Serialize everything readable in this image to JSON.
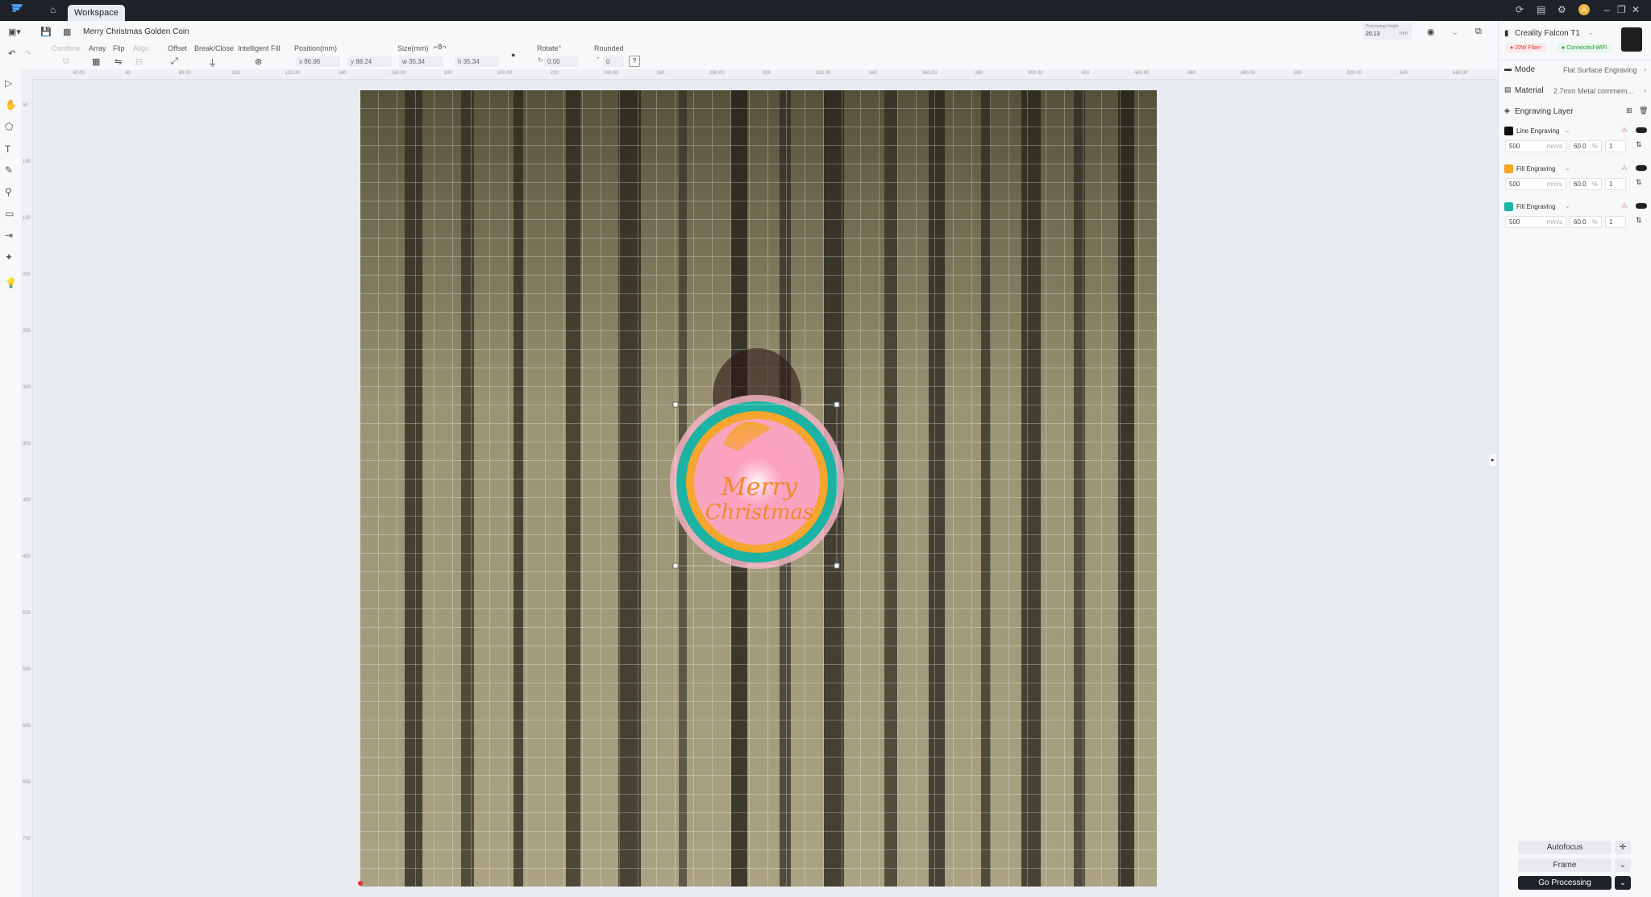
{
  "window": {
    "tab_label": "Workspace"
  },
  "toolbar": {
    "project_name": "Merry Christmas Golden Coin",
    "processing_height_label": "Processing Height",
    "processing_height_value": "20.13",
    "processing_height_unit": "mm",
    "groups": {
      "combine": "Combine",
      "array": "Array",
      "flip": "Flip",
      "align": "Align",
      "offset": "Offset",
      "break_close": "Break/Close",
      "intelligent_fill": "Intelligent Fill",
      "position": "Position(mm)",
      "size": "Size(mm)",
      "rotate": "Rotate°",
      "rounded": "Rounded"
    },
    "fields": {
      "pos_x": "x 86.96",
      "pos_y": "y 88.24",
      "width": "w 35.34",
      "height": "h 35.34",
      "rotate": "0.00",
      "rounded": "0"
    }
  },
  "right_panel": {
    "device_name": "Creality Falcon T1",
    "laser_badge": "20W Fiber",
    "connection_badge": "Connected-WiFi",
    "mode_label": "Mode",
    "mode_value": "Flat Surface Engraving",
    "material_label": "Material",
    "material_value": "2.7mm Metal commem...",
    "engraving_layer_label": "Engraving Layer",
    "layers": [
      {
        "name": "Line Engraving",
        "color": "#111111",
        "speed": "500",
        "speed_unit": "mm/s",
        "power": "60.0",
        "power_unit": "%",
        "passes": "1"
      },
      {
        "name": "Fill Engraving",
        "color": "#f5a623",
        "speed": "500",
        "speed_unit": "mm/s",
        "power": "60.0",
        "power_unit": "%",
        "passes": "1"
      },
      {
        "name": "Fill Engraving",
        "color": "#1bb3a4",
        "speed": "500",
        "speed_unit": "mm/s",
        "power": "60.0",
        "power_unit": "%",
        "passes": "1"
      }
    ],
    "buttons": {
      "autofocus": "Autofocus",
      "frame": "Frame",
      "go_processing": "Go Processing"
    }
  },
  "canvas": {
    "coin_text_line1": "Merry",
    "coin_text_line2": "Christmas",
    "coin_colors": {
      "rim": "#1bb3a4",
      "fill": "#f5a623",
      "center": "#f7a6c0"
    }
  },
  "ruler": {
    "h_ticks": [
      "40.00",
      "60",
      "80.00",
      "100",
      "120.00",
      "140",
      "160.00",
      "180",
      "200.00",
      "220",
      "240.00",
      "260",
      "280.00",
      "300",
      "320.00",
      "340",
      "360.00",
      "380",
      "400.00",
      "420",
      "440.00",
      "460",
      "480.00",
      "500",
      "520.00",
      "540",
      "560.00"
    ],
    "v_ticks": [
      "50",
      "100",
      "150",
      "200",
      "250",
      "300",
      "350",
      "400",
      "450",
      "500",
      "550",
      "600",
      "650",
      "700"
    ]
  },
  "colors": {
    "accent": "#1f2329",
    "primary_button": "#1f2329"
  }
}
